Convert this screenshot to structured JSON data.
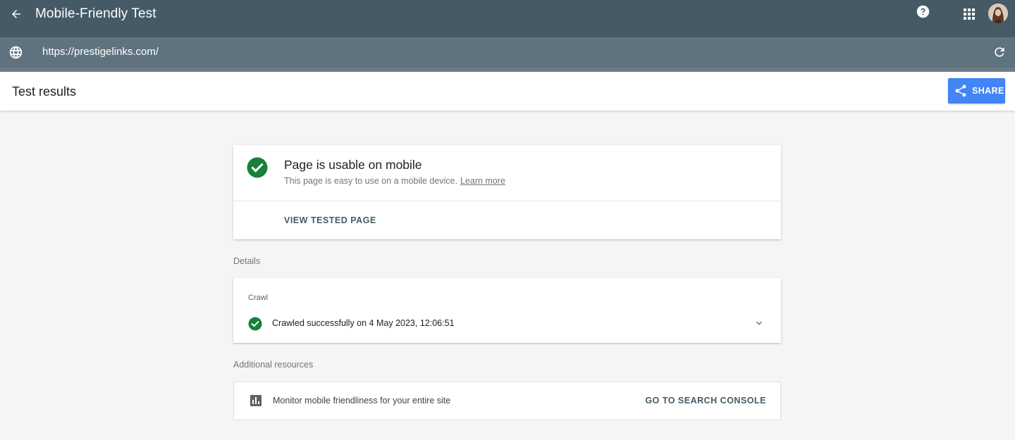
{
  "app": {
    "title": "Mobile-Friendly Test",
    "url": "https://prestigelinks.com/"
  },
  "results": {
    "heading": "Test results",
    "share_label": "SHARE"
  },
  "summary": {
    "headline": "Page is usable on mobile",
    "description": "This page is easy to use on a mobile device.",
    "learn_more": "Learn more",
    "view_tested_page": "VIEW TESTED PAGE"
  },
  "details": {
    "label": "Details",
    "crawl_kicker": "Crawl",
    "crawl_status": "Crawled successfully on 4 May 2023, 12:06:51"
  },
  "additional": {
    "label": "Additional resources",
    "resource_text": "Monitor mobile friendliness for your entire site",
    "resource_cta": "GO TO SEARCH CONSOLE"
  },
  "colors": {
    "appbar": "#455a64",
    "urlbar": "#5f737e",
    "accent_blue": "#4285f4",
    "success_green": "#188038"
  },
  "icons": [
    "back-arrow-icon",
    "help-icon",
    "apps-grid-icon",
    "globe-icon",
    "refresh-icon",
    "share-icon",
    "check-circle-icon",
    "chevron-down-icon",
    "bar-chart-icon"
  ]
}
